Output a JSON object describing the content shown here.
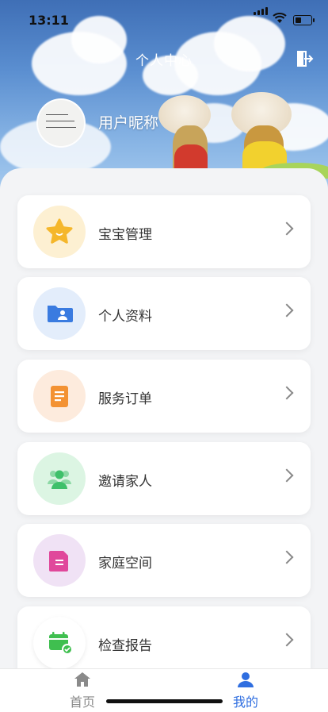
{
  "status_bar": {
    "time": "13:11"
  },
  "header": {
    "title": "个人中心",
    "logout_icon": "logout-icon"
  },
  "profile": {
    "nickname": "用户昵称"
  },
  "menu": [
    {
      "label": "宝宝管理",
      "icon": "star-icon",
      "bg": "#fdf0d2",
      "color": "#f5b72b"
    },
    {
      "label": "个人资料",
      "icon": "profile-folder-icon",
      "bg": "#e3edfb",
      "color": "#3a7be0"
    },
    {
      "label": "服务订单",
      "icon": "order-document-icon",
      "bg": "#fdebdd",
      "color": "#f39233"
    },
    {
      "label": "邀请家人",
      "icon": "invite-family-icon",
      "bg": "#dcf5e3",
      "color": "#3fc06a"
    },
    {
      "label": "家庭空间",
      "icon": "family-space-icon",
      "bg": "#f0e2f5",
      "color": "#e0489b"
    },
    {
      "label": "检查报告",
      "icon": "checkup-report-icon",
      "bg": "#ffffff",
      "color": "#3fbf4f"
    }
  ],
  "tabbar": {
    "home_label": "首页",
    "mine_label": "我的",
    "active_color": "#2f6ee0",
    "inactive_color": "#8a8a8a"
  }
}
